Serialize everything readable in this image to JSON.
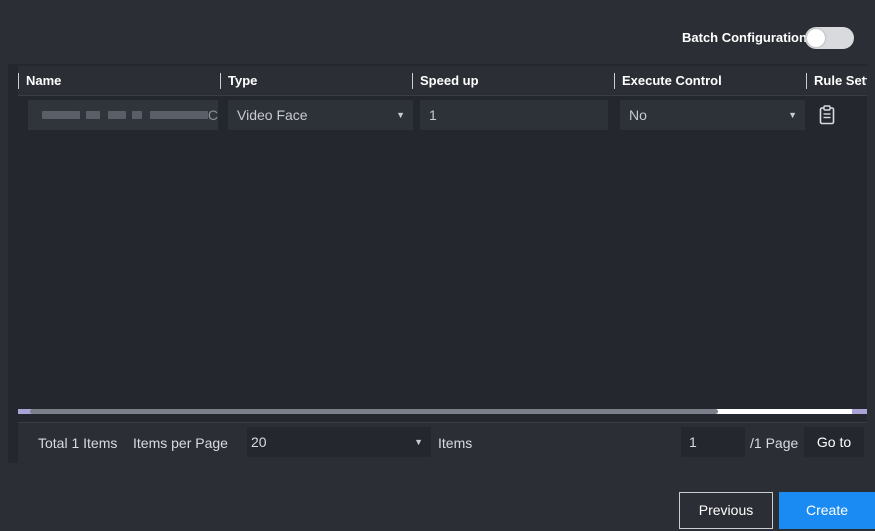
{
  "header": {
    "batch_label": "Batch Configuration",
    "batch_enabled": false
  },
  "table": {
    "columns": [
      {
        "label": "Name"
      },
      {
        "label": "Type"
      },
      {
        "label": "Speed up"
      },
      {
        "label": "Execute Control"
      },
      {
        "label": "Rule Setti"
      }
    ],
    "rows": [
      {
        "name_trailing": "C",
        "type": "Video Face",
        "speed_up": "1",
        "execute_control": "No",
        "rule_icon": "clipboard-icon"
      }
    ]
  },
  "pagination": {
    "total_text": "Total 1 Items",
    "items_per_page_label": "Items per Page",
    "items_per_page_value": "20",
    "items_suffix": "Items",
    "current_page": "1",
    "page_total": "/1 Page",
    "goto_label": "Go to"
  },
  "actions": {
    "previous": "Previous",
    "create": "Create"
  },
  "colors": {
    "accent": "#1a8bf2",
    "background": "#2b2e35",
    "panel": "#24272d"
  }
}
